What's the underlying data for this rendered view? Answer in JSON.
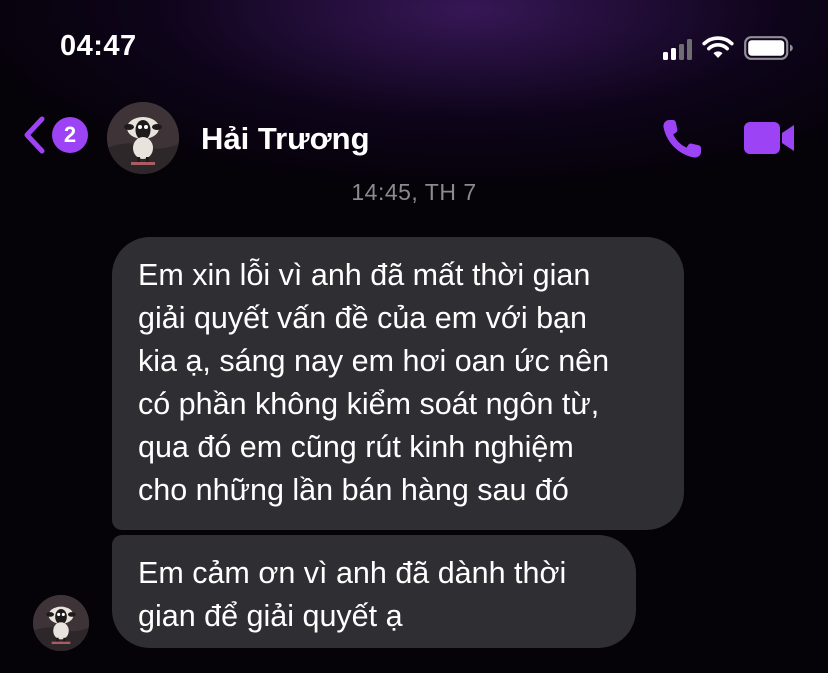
{
  "status_bar": {
    "time": "04:47",
    "icons": [
      "cellular-signal-icon",
      "wifi-icon",
      "battery-icon"
    ]
  },
  "header": {
    "back_icon": "chevron-left-icon",
    "unread_count": "2",
    "contact_name": "Hải Trương",
    "actions": [
      "phone-icon",
      "video-camera-icon"
    ]
  },
  "conversation": {
    "timestamp": "14:45, TH 7",
    "messages": [
      {
        "lines": [
          "Em xin lỗi vì anh đã mất thời gian",
          "giải quyết vấn đề của em với bạn",
          "kia ạ, sáng nay em hơi oan ức nên",
          "có phần không kiểm soát ngôn từ,",
          "qua đó em cũng rút kinh nghiệm",
          "cho những lần bán hàng sau đó"
        ]
      },
      {
        "lines": [
          "Em cảm ơn vì anh đã dành thời",
          "gian để giải quyết ạ"
        ]
      }
    ]
  },
  "colors": {
    "accent": "#9b43f5",
    "bubble": "#2f2f33",
    "timestamp": "#8a8a90",
    "background": "#050208"
  }
}
